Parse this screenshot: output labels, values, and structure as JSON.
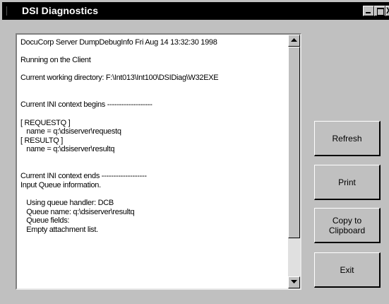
{
  "window": {
    "title": "DSI Diagnostics",
    "controls": {
      "minimize": "_",
      "maximize": "□",
      "close": "X"
    }
  },
  "output": {
    "lines": [
      "DocuCorp Server DumpDebugInfo Fri Aug 14 13:32:30 1998",
      "Running on the Client",
      "Current working directory: F:\\Int013\\Int100\\DSIDiag\\W32EXE",
      "Current INI context begins -------------------",
      "[ REQUESTQ ]",
      "   name = q:\\dsiserver\\requestq",
      "[ RESULTQ ]",
      "   name = q:\\dsiserver\\resultq",
      "Current INI context ends -------------------",
      "Input Queue information.",
      "   Using queue handler: DCB",
      "   Queue name: q:\\dsiserver\\resultq",
      "   Queue fields:",
      "   Empty attachment list."
    ]
  },
  "buttons": {
    "refresh": "Refresh",
    "print": "Print",
    "copy": "Copy to\nClipboard",
    "exit": "Exit"
  }
}
